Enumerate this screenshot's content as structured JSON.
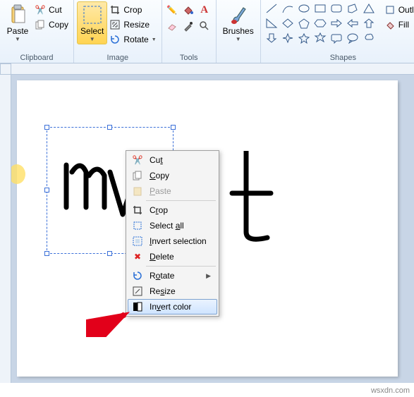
{
  "ribbon": {
    "clipboard": {
      "label": "Clipboard",
      "paste": "Paste",
      "cut": "Cut",
      "copy": "Copy"
    },
    "image": {
      "label": "Image",
      "select": "Select",
      "crop": "Crop",
      "resize": "Resize",
      "rotate": "Rotate"
    },
    "tools": {
      "label": "Tools"
    },
    "brushes": {
      "label": "Brushes",
      "btn": "Brushes"
    },
    "shapes": {
      "label": "Shapes",
      "outline": "Outlin",
      "fill": "Fill"
    }
  },
  "context_menu": {
    "cut": "Cu<u>t</u>",
    "copy": "<u>C</u>opy",
    "paste": "<u>P</u>aste",
    "crop": "C<u>r</u>op",
    "select_all": "Select <u>a</u>ll",
    "invert_selection": "<u>I</u>nvert selection",
    "delete": "<u>D</u>elete",
    "rotate": "R<u>o</u>tate",
    "resize": "Re<u>s</u>ize",
    "invert_color": "In<u>v</u>ert color"
  },
  "ghost": {
    "clipboard": "Clipboard",
    "image": "Image",
    "tools": "Tools",
    "shapes": "Shapes"
  },
  "watermark": "wsxdn.com"
}
